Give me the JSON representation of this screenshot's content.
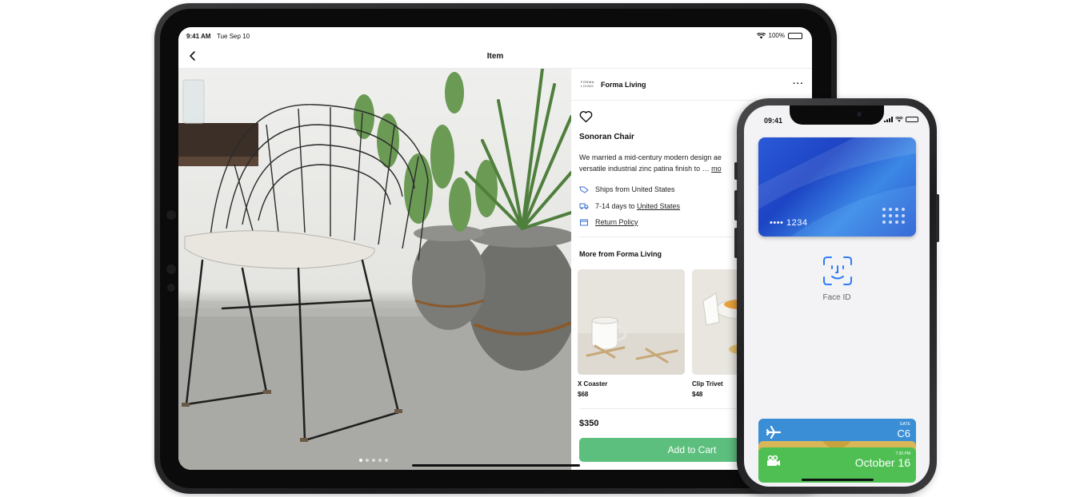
{
  "ipad": {
    "status": {
      "time": "9:41 AM",
      "date": "Tue Sep 10",
      "battery": "100%"
    },
    "nav": {
      "title": "Item"
    },
    "photo": {
      "page_count": 5,
      "active_page": 1
    },
    "seller": {
      "logo_line1": "FORMA",
      "logo_line2": "LIVING",
      "name": "Forma Living"
    },
    "product": {
      "title": "Sonoran Chair",
      "description_line1": "We married a mid-century modern design ae",
      "description_line2": "versatile industrial zinc patina finish to … ",
      "more_link": "mo",
      "ships_from": "Ships from United States",
      "delivery_prefix": "7-14 days to ",
      "delivery_country": "United States",
      "return_policy": "Return Policy"
    },
    "more_from": {
      "title": "More from Forma Living",
      "items": [
        {
          "name": "X Coaster",
          "price": "$68"
        },
        {
          "name": "Clip Trivet",
          "price": "$48"
        }
      ]
    },
    "price": "$350",
    "cart_button": "Add to Cart"
  },
  "iphone": {
    "status_time": "09:41",
    "card_number": "•••• 1234",
    "faceid_label": "Face ID",
    "boarding_pass": {
      "gate_label": "GATE",
      "gate": "C6"
    },
    "ticket": {
      "time_label": "7:30 PM",
      "date": "October 16"
    }
  },
  "colors": {
    "cart_green": "#5cbf7d",
    "card_blue": "#1d44c4",
    "pass_blue": "#3a8ed6",
    "pass_green": "#4fbf53",
    "pass_gold": "#d9b657"
  }
}
